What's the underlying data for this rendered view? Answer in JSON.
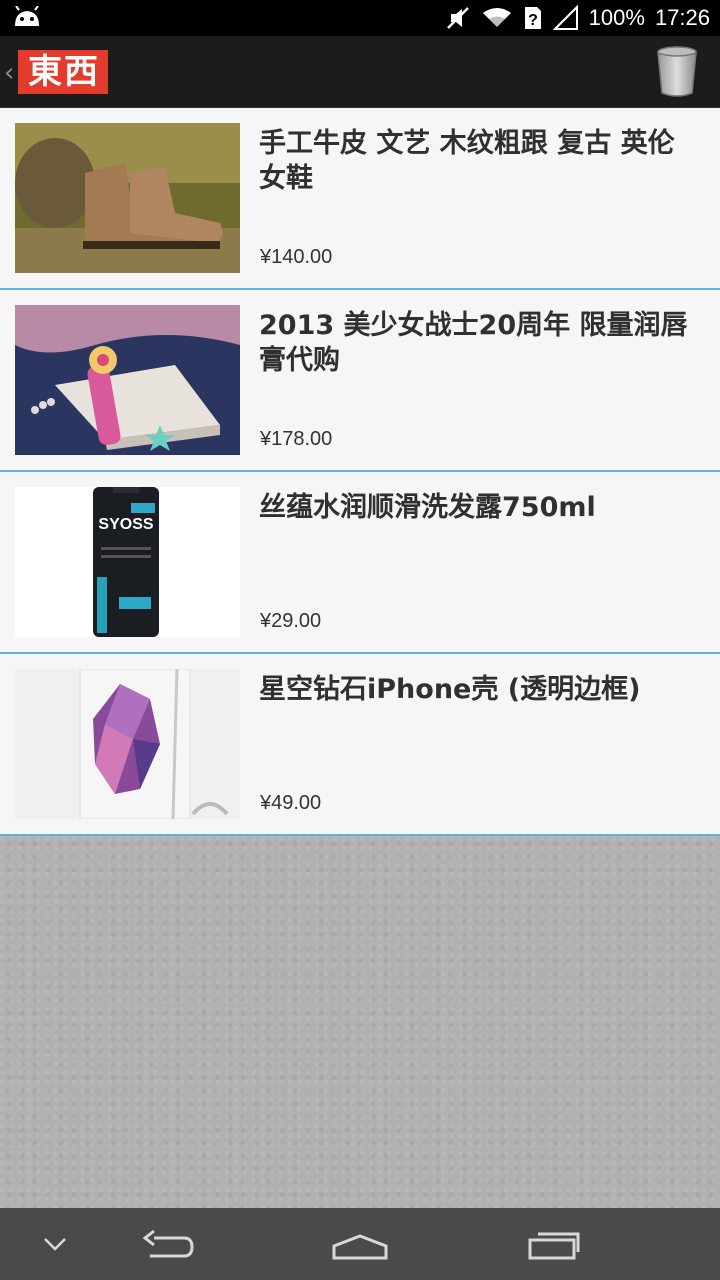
{
  "status_bar": {
    "battery": "100%",
    "time": "17:26"
  },
  "action_bar": {
    "logo_text": [
      "東",
      "西"
    ]
  },
  "products": [
    {
      "title": "手工牛皮 文艺 木纹粗跟 复古 英伦 女鞋",
      "price": "¥140.00",
      "image": "brown-boots-photo"
    },
    {
      "title": "2013 美少女战士20周年 限量润唇膏代购",
      "price": "¥178.00",
      "image": "sailor-moon-lipbalm-photo"
    },
    {
      "title": "丝蕴水润顺滑洗发露750ml",
      "price": "¥29.00",
      "image": "syoss-shampoo-photo"
    },
    {
      "title": "星空钻石iPhone壳 (透明边框)",
      "price": "¥49.00",
      "image": "crystal-iphone-case-photo"
    }
  ],
  "colors": {
    "divider": "#5cb3de",
    "logo_red": "#e43c2c",
    "action_bar": "#1c1c1c",
    "nav_bar": "#4a4a4a"
  }
}
